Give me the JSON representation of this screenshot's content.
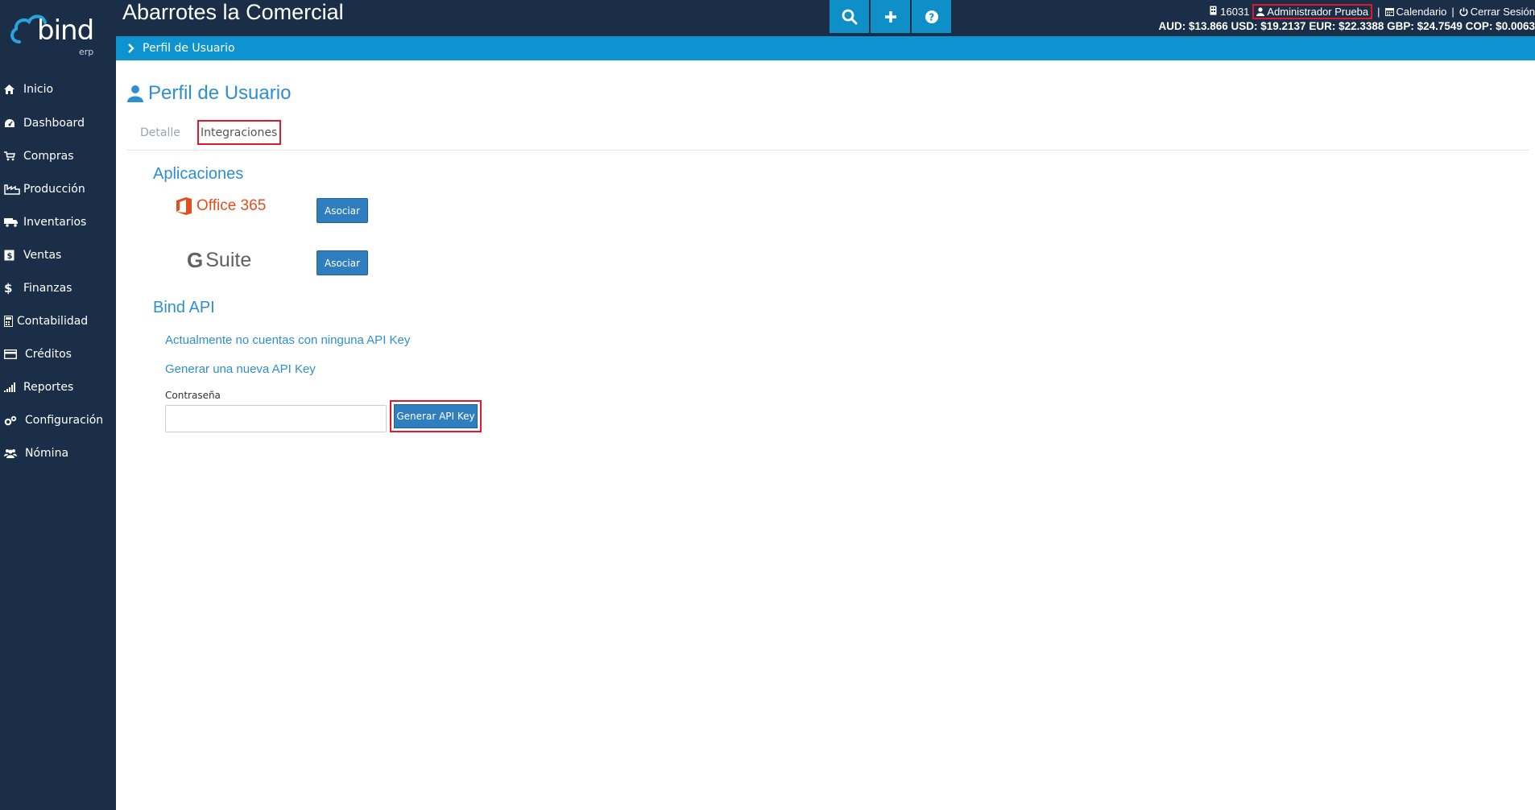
{
  "header": {
    "app_title": "Abarrotes la Comercial",
    "account_number": "16031",
    "user_name": "Administrador Prueba",
    "calendar_label": "Calendario",
    "logout_label": "Cerrar Sesión",
    "rates": "AUD: $13.866 USD: $19.2137 EUR: $22.3388 GBP: $24.7549 COP: $0.0063"
  },
  "logo": {
    "word": "bind",
    "sub": "erp"
  },
  "sidebar": {
    "items": [
      {
        "label": "Inicio",
        "icon": "home-icon"
      },
      {
        "label": "Dashboard",
        "icon": "dashboard-icon"
      },
      {
        "label": "Compras",
        "icon": "cart-icon"
      },
      {
        "label": "Producción",
        "icon": "industry-icon"
      },
      {
        "label": "Inventarios",
        "icon": "truck-icon"
      },
      {
        "label": "Ventas",
        "icon": "sales-icon"
      },
      {
        "label": "Finanzas",
        "icon": "dollar-icon"
      },
      {
        "label": "Contabilidad",
        "icon": "calculator-icon"
      },
      {
        "label": "Créditos",
        "icon": "credit-card-icon"
      },
      {
        "label": "Reportes",
        "icon": "signal-icon"
      },
      {
        "label": "Configuración",
        "icon": "gears-icon"
      },
      {
        "label": "Nómina",
        "icon": "users-icon"
      }
    ]
  },
  "breadcrumb": {
    "label": "Perfil de Usuario"
  },
  "page": {
    "title": "Perfil de Usuario",
    "tabs": {
      "detail": "Detalle",
      "integrations": "Integraciones"
    },
    "apps_section": "Aplicaciones",
    "office_label": "Office 365",
    "gsuite_g": "G",
    "gsuite_label": "Suite",
    "associate_label": "Asociar",
    "api_section": "Bind API",
    "no_key_text": "Actualmente no cuentas con ninguna API Key",
    "new_key_text": "Generar una nueva API Key",
    "password_label": "Contraseña",
    "password_value": "",
    "generate_label": "Generar API Key"
  },
  "colors": {
    "sidebar_bg": "#1b2e48",
    "accent": "#0d93cf",
    "primary_button": "#2f7ec0",
    "highlight": "#e0182e",
    "link": "#2e8fd0"
  }
}
